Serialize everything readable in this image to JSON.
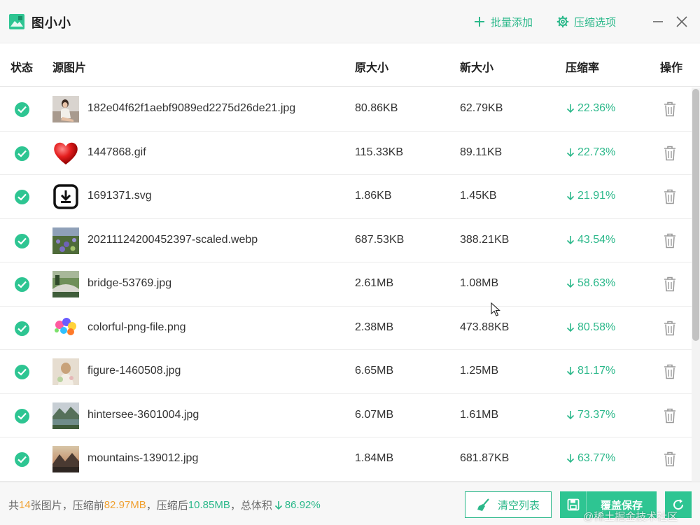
{
  "app": {
    "title": "图小小",
    "accent": "#2ec592",
    "accent_text": "#2bb88a"
  },
  "toolbar": {
    "batch_add": "批量添加",
    "compress_options": "压缩选项"
  },
  "table": {
    "headers": {
      "status": "状态",
      "source": "源图片",
      "orig_size": "原大小",
      "new_size": "新大小",
      "ratio": "压缩率",
      "action": "操作"
    },
    "rows": [
      {
        "name": "182e04f62f1aebf9089ed2275d26de21.jpg",
        "orig": "80.86KB",
        "new": "62.79KB",
        "rate": "22.36%",
        "thumb": "photo-person"
      },
      {
        "name": "1447868.gif",
        "orig": "115.33KB",
        "new": "89.11KB",
        "rate": "22.73%",
        "thumb": "red-heart"
      },
      {
        "name": "1691371.svg",
        "orig": "1.86KB",
        "new": "1.45KB",
        "rate": "21.91%",
        "thumb": "download-box-icon"
      },
      {
        "name": "20211124200452397-scaled.webp",
        "orig": "687.53KB",
        "new": "388.21KB",
        "rate": "43.54%",
        "thumb": "photo-flowers"
      },
      {
        "name": "bridge-53769.jpg",
        "orig": "2.61MB",
        "new": "1.08MB",
        "rate": "58.63%",
        "thumb": "photo-bridge"
      },
      {
        "name": "colorful-png-file.png",
        "orig": "2.38MB",
        "new": "473.88KB",
        "rate": "80.58%",
        "thumb": "colorful-splash"
      },
      {
        "name": "figure-1460508.jpg",
        "orig": "6.65MB",
        "new": "1.25MB",
        "rate": "81.17%",
        "thumb": "photo-figure"
      },
      {
        "name": "hintersee-3601004.jpg",
        "orig": "6.07MB",
        "new": "1.61MB",
        "rate": "73.37%",
        "thumb": "photo-lake"
      },
      {
        "name": "mountains-139012.jpg",
        "orig": "1.84MB",
        "new": "681.87KB",
        "rate": "63.77%",
        "thumb": "photo-mountains"
      }
    ]
  },
  "footer": {
    "prefix": "共",
    "count": "14",
    "count_suffix": "张图片，压缩前",
    "before_size": "82.97MB",
    "after_label": "，压缩后",
    "after_size": "10.85MB",
    "total_label": "，总体积",
    "total_ratio": "86.92%",
    "clear_label": "清空列表",
    "save_label": "覆盖保存"
  },
  "watermark": "@稀土掘金技术社区"
}
